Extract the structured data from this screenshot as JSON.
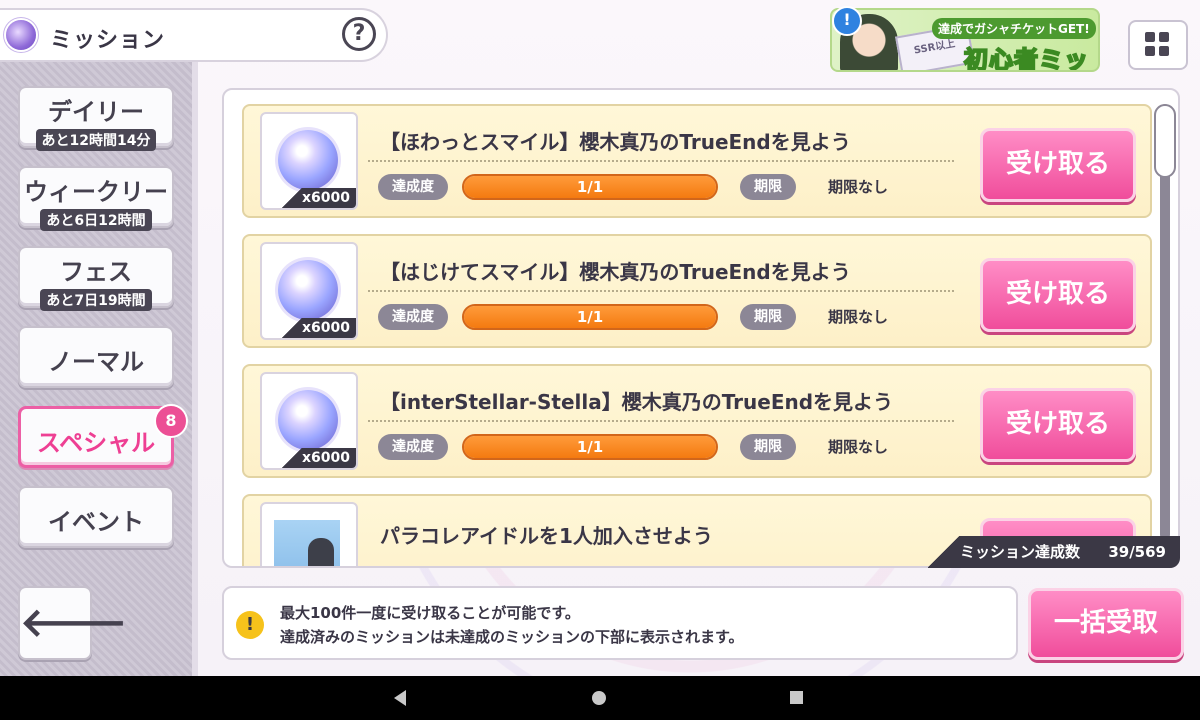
{
  "header": {
    "title": "ミッション",
    "help_icon": "?"
  },
  "banner": {
    "top_text": "達成でガシャチケットGET!",
    "main_text": "初心者ミッション",
    "ticket_text": "SSR以上",
    "alert_icon": "!"
  },
  "nav": {
    "daily": {
      "label": "デイリー",
      "timer": "あと12時間14分"
    },
    "weekly": {
      "label": "ウィークリー",
      "timer": "あと6日12時間"
    },
    "fes": {
      "label": "フェス",
      "timer": "あと7日19時間"
    },
    "normal": {
      "label": "ノーマル"
    },
    "special": {
      "label": "スペシャル",
      "badge": "8"
    },
    "event": {
      "label": "イベント"
    },
    "back_icon": "🡐"
  },
  "missions": [
    {
      "title": "【ほわっとスマイル】櫻木真乃のTrueEndを見よう",
      "reward_qty": "x6000",
      "progress_label": "達成度",
      "progress": "1/1",
      "progress_ratio": 1.0,
      "deadline_label": "期限",
      "deadline": "期限なし",
      "button": "受け取る"
    },
    {
      "title": "【はじけてスマイル】櫻木真乃のTrueEndを見よう",
      "reward_qty": "x6000",
      "progress_label": "達成度",
      "progress": "1/1",
      "progress_ratio": 1.0,
      "deadline_label": "期限",
      "deadline": "期限なし",
      "button": "受け取る"
    },
    {
      "title": "【interStellar-Stella】櫻木真乃のTrueEndを見よう",
      "reward_qty": "x6000",
      "progress_label": "達成度",
      "progress": "1/1",
      "progress_ratio": 1.0,
      "deadline_label": "期限",
      "deadline": "期限なし",
      "button": "受け取る"
    },
    {
      "title": "パラコレアイドルを1人加入させよう"
    }
  ],
  "count": {
    "label": "ミッション達成数",
    "value": "39/569"
  },
  "info": {
    "icon": "!",
    "line1": "最大100件一度に受け取ることが可能です。",
    "line2": "達成済みのミッションは未達成のミッションの下部に表示されます。"
  },
  "bulk_button": "一括受取",
  "colors": {
    "accent_pink": "#f04d9b",
    "progress_orange": "#f47a10",
    "card_bg": "#fff7d8"
  }
}
